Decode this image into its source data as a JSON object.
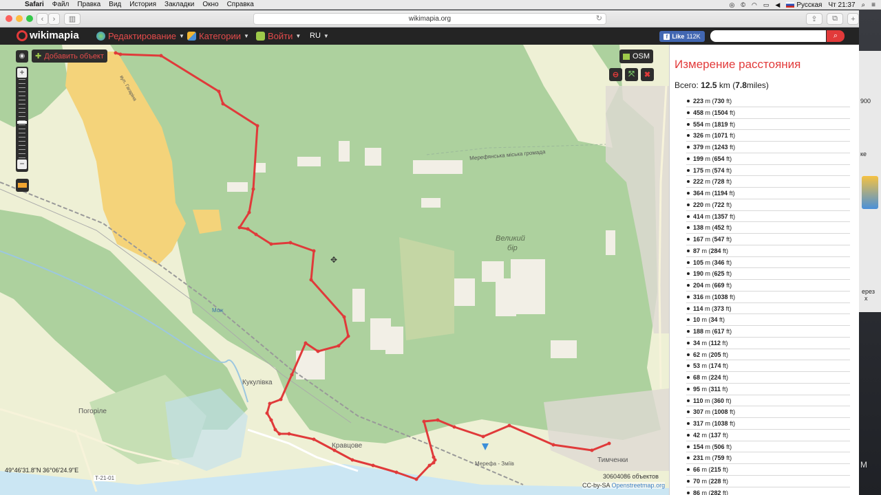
{
  "menubar": {
    "app": "Safari",
    "items": [
      "Файл",
      "Правка",
      "Вид",
      "История",
      "Закладки",
      "Окно",
      "Справка"
    ],
    "input_source": "Русская",
    "clock": "Чт 21:37"
  },
  "browser": {
    "url": "wikimapia.org"
  },
  "wikimapia": {
    "logo": "wikimapia",
    "nav": {
      "edit": "Редактирование",
      "categories": "Категории",
      "login": "Войти",
      "lang": "RU"
    },
    "like_label": "Like",
    "like_count": "112K",
    "search_placeholder": ""
  },
  "map": {
    "add_object": "Добавить объект",
    "layer_label": "OSM",
    "coordinates": "49°46'31.8\"N 36°06'24.9\"E",
    "object_count": "30604086 объектов",
    "attribution_prefix": "CC-by-SA",
    "attribution_link": "Openstreetmap.org",
    "zoom_level_fraction": 0.55,
    "labels": {
      "forest_name": "Великий",
      "forest_name2": "бір",
      "village1": "Кукулівка",
      "village2": "Погоріле",
      "village3": "Кравцове",
      "village4": "Тимченки",
      "hromada1": "Мерефянська міська громада",
      "station": "Мерефа - Зміїв",
      "road": "Т-21-01",
      "river": "Мож",
      "street": "вул. Гагаріна"
    },
    "colors": {
      "route": "#e03a3a",
      "forest": "#add19e",
      "urban": "#f4d37a",
      "field": "#eef0d5"
    }
  },
  "panel": {
    "title": "Измерение расстояния",
    "total_prefix": "Всего:",
    "total_km": "12.5",
    "total_km_unit": "km",
    "total_miles": "7.8",
    "total_miles_unit": "miles",
    "segments": [
      {
        "m": "223",
        "ft": "730"
      },
      {
        "m": "458",
        "ft": "1504"
      },
      {
        "m": "554",
        "ft": "1819"
      },
      {
        "m": "326",
        "ft": "1071"
      },
      {
        "m": "379",
        "ft": "1243"
      },
      {
        "m": "199",
        "ft": "654"
      },
      {
        "m": "175",
        "ft": "574"
      },
      {
        "m": "222",
        "ft": "728"
      },
      {
        "m": "364",
        "ft": "1194"
      },
      {
        "m": "220",
        "ft": "722"
      },
      {
        "m": "414",
        "ft": "1357"
      },
      {
        "m": "138",
        "ft": "452"
      },
      {
        "m": "167",
        "ft": "547"
      },
      {
        "m": "87",
        "ft": "284"
      },
      {
        "m": "105",
        "ft": "346"
      },
      {
        "m": "190",
        "ft": "625"
      },
      {
        "m": "204",
        "ft": "669"
      },
      {
        "m": "316",
        "ft": "1038"
      },
      {
        "m": "114",
        "ft": "373"
      },
      {
        "m": "10",
        "ft": "34"
      },
      {
        "m": "188",
        "ft": "617"
      },
      {
        "m": "34",
        "ft": "112"
      },
      {
        "m": "62",
        "ft": "205"
      },
      {
        "m": "53",
        "ft": "174"
      },
      {
        "m": "68",
        "ft": "224"
      },
      {
        "m": "95",
        "ft": "311"
      },
      {
        "m": "110",
        "ft": "360"
      },
      {
        "m": "307",
        "ft": "1008"
      },
      {
        "m": "317",
        "ft": "1038"
      },
      {
        "m": "42",
        "ft": "137"
      },
      {
        "m": "154",
        "ft": "506"
      },
      {
        "m": "231",
        "ft": "759"
      },
      {
        "m": "66",
        "ft": "215"
      },
      {
        "m": "70",
        "ft": "228"
      },
      {
        "m": "86",
        "ft": "282"
      }
    ]
  },
  "background_window": {
    "texts": [
      "900",
      "ке",
      "ерез",
      "х",
      "М"
    ]
  }
}
